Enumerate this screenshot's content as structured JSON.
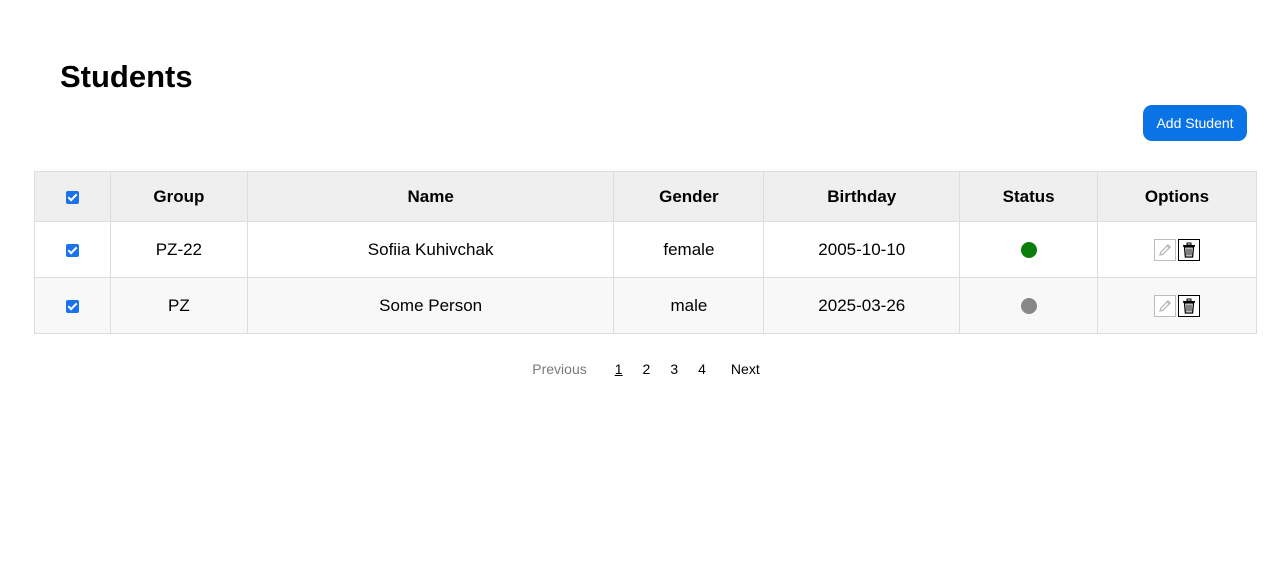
{
  "page": {
    "title": "Students"
  },
  "toolbar": {
    "add_label": "Add Student"
  },
  "table": {
    "headers": {
      "group": "Group",
      "name": "Name",
      "gender": "Gender",
      "birthday": "Birthday",
      "status": "Status",
      "options": "Options"
    },
    "select_all_checked": true,
    "rows": [
      {
        "checked": true,
        "group": "PZ-22",
        "name": "Sofiia Kuhivchak",
        "gender": "female",
        "birthday": "2005-10-10",
        "status": "active",
        "status_color": "#0a7d0a"
      },
      {
        "checked": true,
        "group": "PZ",
        "name": "Some Person",
        "gender": "male",
        "birthday": "2025-03-26",
        "status": "inactive",
        "status_color": "#888888"
      }
    ]
  },
  "pagination": {
    "previous_label": "Previous",
    "next_label": "Next",
    "pages": [
      "1",
      "2",
      "3",
      "4"
    ],
    "current_page": "1"
  },
  "colors": {
    "accent": "#0a74e6",
    "header_bg": "#efefef",
    "status_active": "#0a7d0a",
    "status_inactive": "#888888"
  },
  "icons": {
    "edit": "pencil-icon",
    "delete": "trash-icon"
  }
}
